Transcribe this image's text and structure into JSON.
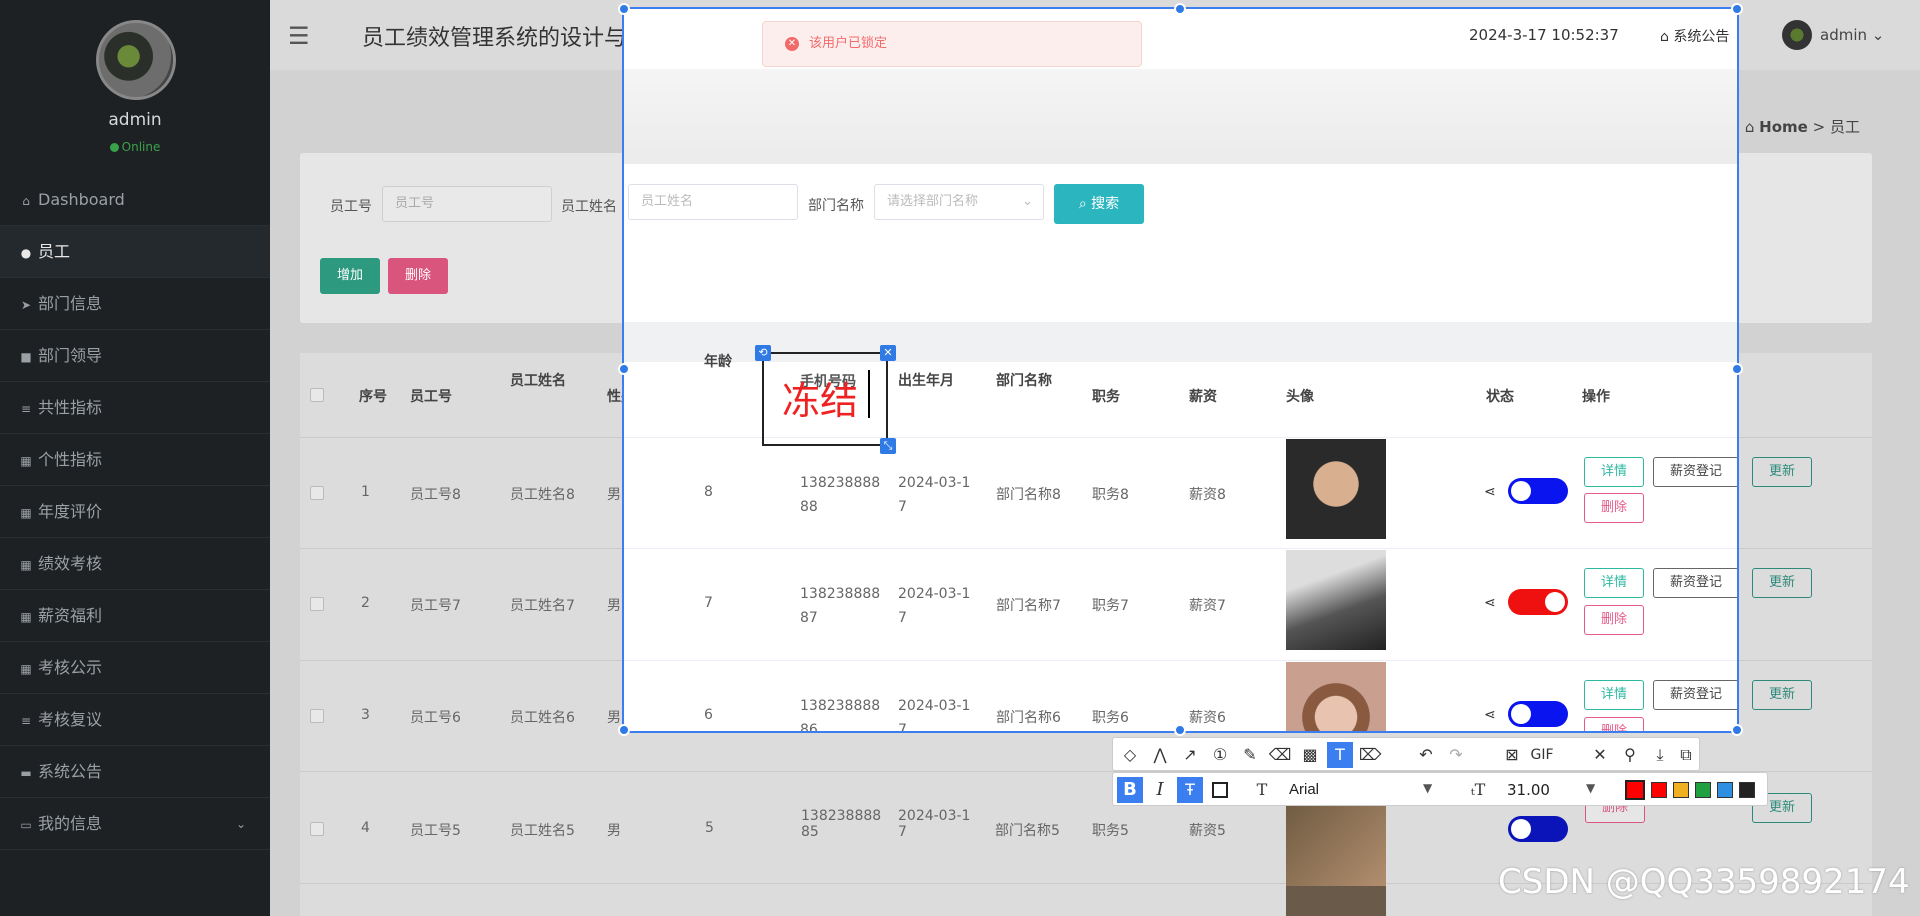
{
  "app": {
    "title": "员工绩效管理系统的设计与实现",
    "datetime": "2024-3-17 10:52:37",
    "notice_label": "系统公告",
    "user": "admin"
  },
  "sidebar": {
    "username": "admin",
    "status": "Online",
    "items": [
      {
        "label": "Dashboard",
        "icon": "home-icon"
      },
      {
        "label": "员工",
        "icon": "marker-icon"
      },
      {
        "label": "部门信息",
        "icon": "send-icon"
      },
      {
        "label": "部门领导",
        "icon": "book-icon"
      },
      {
        "label": "共性指标",
        "icon": "list-icon"
      },
      {
        "label": "个性指标",
        "icon": "grid-icon"
      },
      {
        "label": "年度评价",
        "icon": "grid-icon"
      },
      {
        "label": "绩效考核",
        "icon": "grid-icon"
      },
      {
        "label": "薪资福利",
        "icon": "grid-icon"
      },
      {
        "label": "考核公示",
        "icon": "grid-icon"
      },
      {
        "label": "考核复议",
        "icon": "list-icon"
      },
      {
        "label": "系统公告",
        "icon": "card-icon"
      },
      {
        "label": "我的信息",
        "icon": "window-icon"
      }
    ]
  },
  "breadcrumb": {
    "home": "Home",
    "sep": ">",
    "current": "员工"
  },
  "alert": {
    "message": "该用户已锁定"
  },
  "search": {
    "emp_no_label": "员工号",
    "emp_no_placeholder": "员工号",
    "emp_name_label": "员工姓名",
    "emp_name_placeholder": "员工姓名",
    "dept_label": "部门名称",
    "dept_placeholder": "请选择部门名称",
    "search_button": "搜索",
    "add_button": "增加",
    "delete_button": "删除"
  },
  "table": {
    "headers": [
      "序号",
      "员工号",
      "员工姓名",
      "性别",
      "年龄",
      "手机号码",
      "出生年月",
      "部门名称",
      "职务",
      "薪资",
      "头像",
      "状态",
      "操作"
    ],
    "rows": [
      {
        "idx": "1",
        "no": "员工号8",
        "name": "员工姓名8",
        "gender": "男",
        "age": "8",
        "phone1": "138238888",
        "phone2": "88",
        "birth1": "2024-03-1",
        "birth2": "7",
        "dept": "部门名称8",
        "job": "职务8",
        "salary": "薪资8"
      },
      {
        "idx": "2",
        "no": "员工号7",
        "name": "员工姓名7",
        "gender": "男",
        "age": "7",
        "phone1": "138238888",
        "phone2": "87",
        "birth1": "2024-03-1",
        "birth2": "7",
        "dept": "部门名称7",
        "job": "职务7",
        "salary": "薪资7"
      },
      {
        "idx": "3",
        "no": "员工号6",
        "name": "员工姓名6",
        "gender": "男",
        "age": "6",
        "phone1": "138238888",
        "phone2": "86",
        "birth1": "2024-03-1",
        "birth2": "7",
        "dept": "部门名称6",
        "job": "职务6",
        "salary": "薪资6"
      },
      {
        "idx": "4",
        "no": "员工号5",
        "name": "员工姓名5",
        "gender": "男",
        "age": "5",
        "phone1": "138238888",
        "phone2": "85",
        "birth1": "2024-03-1",
        "birth2": "7",
        "dept": "部门名称5",
        "job": "职务5",
        "salary": "薪资5"
      }
    ],
    "actions": {
      "detail": "详情",
      "salary": "薪资登记",
      "update": "更新",
      "delete": "删除"
    }
  },
  "annotation": {
    "text": "冻结"
  },
  "toolbar": {
    "font": "Arial",
    "font_size": "31.00",
    "gif": "GIF",
    "bold": "B",
    "italic": "I",
    "colors": [
      "#ff0000",
      "#ff0000",
      "#f0b020",
      "#20a040",
      "#2f8fe0",
      "#222222",
      "#ffffff"
    ]
  },
  "watermark": "CSDN @QQ3359892174"
}
